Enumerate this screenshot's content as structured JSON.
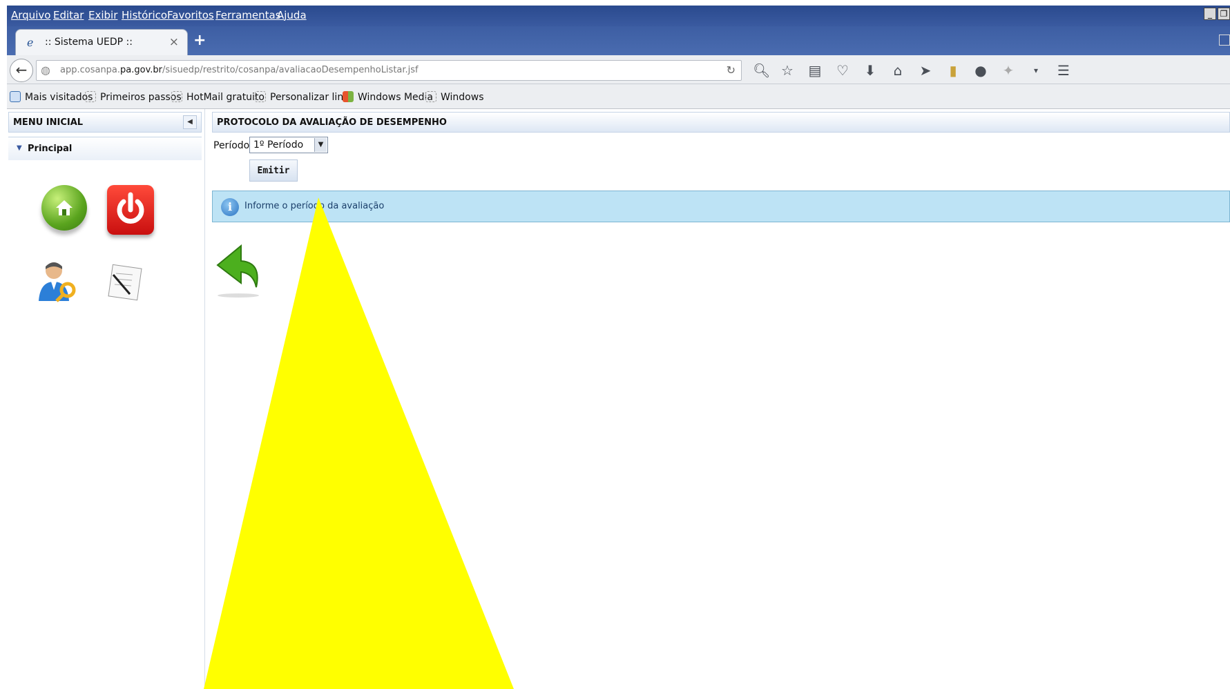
{
  "menubar": {
    "items": [
      "Arquivo",
      "Editar",
      "Exibir",
      "Histórico",
      "Favoritos",
      "Ferramentas",
      "Ajuda"
    ]
  },
  "tab": {
    "title": ":: Sistema UEDP ::",
    "close": "×",
    "new_tab": "+"
  },
  "navbar": {
    "url_prefix": "app.cosanpa.",
    "url_domain": "pa.gov.br",
    "url_path": "/sisuedp/restrito/cosanpa/avaliacaoDesempenhoListar.jsf",
    "icons": [
      "search-dropdown-icon",
      "star-icon",
      "reading-list-icon",
      "pocket-icon",
      "download-icon",
      "home-icon",
      "send-icon",
      "bookmark-icon",
      "chat-icon",
      "addon-icon",
      "overflow-icon",
      "hamburger-menu-icon"
    ]
  },
  "bookmarks": {
    "items": [
      "Mais visitados",
      "Primeiros passos",
      "HotMail gratuito",
      "Personalizar links",
      "Windows Media",
      "Windows"
    ]
  },
  "sidebar": {
    "title": "MENU INICIAL",
    "section": "Principal"
  },
  "main": {
    "title": "PROTOCOLO DA AVALIAÇÃO DE DESEMPENHO",
    "periodo_label": "Período:",
    "periodo_value": "1º Período",
    "emitir_label": "Emitir",
    "info_text": "Informe o período da avaliação"
  },
  "colors": {
    "titlebar": "#2a4a8e",
    "info_bg": "#bde3f5",
    "annotation_yellow": "#ffff00"
  }
}
